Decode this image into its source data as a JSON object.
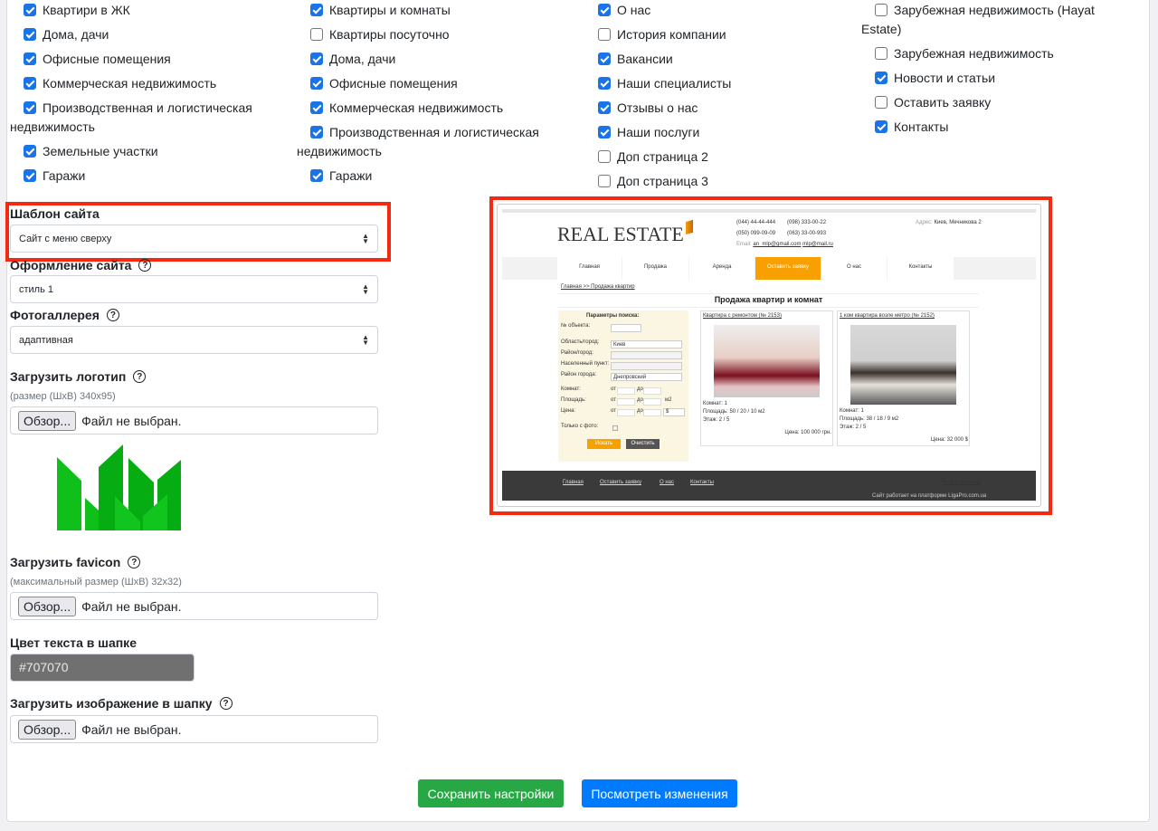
{
  "columns": [
    [
      {
        "label": "Квартири в ЖК",
        "checked": true
      },
      {
        "label": "Дома, дачи",
        "checked": true
      },
      {
        "label": "Офисные помещения",
        "checked": true
      },
      {
        "label": "Коммерческая недвижимость",
        "checked": true
      },
      {
        "label": "Производственная и логистическая недвижимость",
        "checked": true
      },
      {
        "label": "Земельные участки",
        "checked": true
      },
      {
        "label": "Гаражи",
        "checked": true
      }
    ],
    [
      {
        "label": "Квартиры и комнаты",
        "checked": true
      },
      {
        "label": "Квартиры посуточно",
        "checked": false
      },
      {
        "label": "Дома, дачи",
        "checked": true
      },
      {
        "label": "Офисные помещения",
        "checked": true
      },
      {
        "label": "Коммерческая недвижимость",
        "checked": true
      },
      {
        "label": "Производственная и логистическая недвижимость",
        "checked": true
      },
      {
        "label": "Гаражи",
        "checked": true
      }
    ],
    [
      {
        "label": "О нас",
        "checked": true
      },
      {
        "label": "История компании",
        "checked": false
      },
      {
        "label": "Вакансии",
        "checked": true
      },
      {
        "label": "Наши специалисты",
        "checked": true
      },
      {
        "label": "Отзывы о нас",
        "checked": true
      },
      {
        "label": "Наши послуги",
        "checked": true
      },
      {
        "label": "Доп страница 2",
        "checked": false
      },
      {
        "label": "Доп страница 3",
        "checked": false
      }
    ],
    [
      {
        "label": "Зарубежная недвижимость (Hayat Estate)",
        "checked": false
      },
      {
        "label": "Зарубежная недвижимость",
        "checked": false
      },
      {
        "label": "Новости и статьи",
        "checked": true
      },
      {
        "label": "Оставить заявку",
        "checked": false
      },
      {
        "label": "Контакты",
        "checked": true
      }
    ]
  ],
  "form": {
    "template_label": "Шаблон сайта",
    "template_value": "Сайт с меню сверху",
    "style_label": "Оформление сайта",
    "style_value": "стиль 1",
    "gallery_label": "Фотогаллерея",
    "gallery_value": "адаптивная",
    "logo_label": "Загрузить логотип",
    "logo_hint": "(размер (ШхВ) 340x95)",
    "favicon_label": "Загрузить favicon",
    "favicon_hint": "(максимальный размер (ШхВ) 32x32)",
    "header_color_label": "Цвет текста в шапке",
    "header_color_value": "#707070",
    "header_image_label": "Загрузить изображение в шапку",
    "browse": "Обзор...",
    "no_file": "Файл не выбран.",
    "help": "?"
  },
  "buttons": {
    "save": "Сохранить настройки",
    "preview": "Посмотреть изменения"
  },
  "colors": {
    "save": "#28a745",
    "preview": "#007bff",
    "highlight": "#f5290f",
    "logo_green": "#0fbf1a",
    "preview_accent": "#f7a000"
  },
  "preview": {
    "logo": "REAL ESTATE",
    "phones": [
      "(044) 44-44-444",
      "(098) 333-00-22",
      "(050) 099-09-09",
      "(063) 33-00-993"
    ],
    "email_label": "Email:",
    "emails": [
      "an_mlp@gmail.com",
      "mlp@mail.ru"
    ],
    "address_label": "Адрес:",
    "address": "Киев, Мечникова 2",
    "nav": [
      "Главная",
      "Продажа",
      "Аренда",
      "Оставить заявку",
      "О нас",
      "Контакты"
    ],
    "breadcrumb": "Главная >> Продажа квартир",
    "title": "Продажа квартир и комнат",
    "search": {
      "title": "Параметры поиска:",
      "fields": [
        "№ объекта:",
        "Область/город:",
        "Район/город:",
        "Населенный пункт:",
        "Район города:"
      ],
      "city": "Киев",
      "district": "Днепровский",
      "rooms": "Комнат:",
      "area": "Площадь:",
      "price": "Цена:",
      "from": "от",
      "to": "до",
      "m2": "м2",
      "currency": "$",
      "photo_only": "Только с фото:",
      "search_btn": "Искать",
      "clear_btn": "Очистить"
    },
    "listings": [
      {
        "title": "Квартира с ремонтом (№ 2153)",
        "rooms": "Комнат: 1",
        "area": "Площадь: 50 / 20 / 10 м2",
        "floor": "Этаж: 2 / 5",
        "price": "Цена: 100 000 грн."
      },
      {
        "title": "1 ком квартира возле метро (№ 2152)",
        "rooms": "Комнат: 1",
        "area": "Площадь: 38 / 18 / 9 м2",
        "floor": "Этаж: 2 / 5",
        "price": "Цена: 32 000 $"
      }
    ],
    "footer_links": [
      "Главная",
      "Оставить заявку",
      "О нас",
      "Контакты"
    ],
    "login": "Вход в систему",
    "powered": "Сайт работает на платформе LigaPro.com.ua"
  }
}
